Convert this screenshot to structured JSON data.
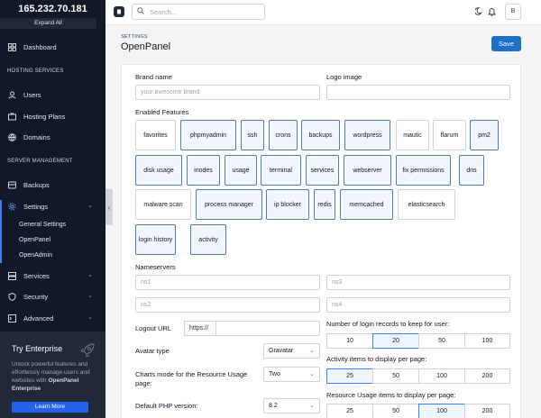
{
  "sidebar": {
    "ip": "165.232.70.181",
    "expand_all": "Expand All",
    "dashboard": "Dashboard",
    "section_hosting": "HOSTING SERVICES",
    "users": "Users",
    "hosting_plans": "Hosting Plans",
    "domains": "Domains",
    "section_server": "SERVER MANAGEMENT",
    "backups": "Backups",
    "settings": "Settings",
    "sub": [
      "General Settings",
      "OpenPanel",
      "OpenAdmin"
    ],
    "services": "Services",
    "security": "Security",
    "advanced": "Advanced",
    "enterprise_title": "Try Enterprise",
    "enterprise_text_1": "Unlock powerful features and effortlessly manage users and websites with",
    "enterprise_text_2": "OpenPanel Enterprise",
    "learn_more": "Learn More"
  },
  "topbar": {
    "search_placeholder": "Search...",
    "avatar": "B"
  },
  "header": {
    "crumb": "SETTINGS",
    "title": "OpenPanel",
    "save": "Save"
  },
  "form": {
    "brand_name_label": "Brand name",
    "brand_name_placeholder": "your awesome brand",
    "logo_label": "Logo image",
    "features_label": "Enabled Features",
    "features": [
      {
        "name": "favorites",
        "on": false
      },
      {
        "name": "phpmyadmin",
        "on": true
      },
      {
        "name": "ssh",
        "on": true
      },
      {
        "name": "crons",
        "on": true
      },
      {
        "name": "backups",
        "on": true
      },
      {
        "name": "wordpress",
        "on": true
      },
      {
        "name": "mautic",
        "on": false
      },
      {
        "name": "flarum",
        "on": false
      },
      {
        "name": "pm2",
        "on": true
      },
      {
        "name": "disk usage",
        "on": true
      },
      {
        "name": "inodes",
        "on": true
      },
      {
        "name": "usage",
        "on": true
      },
      {
        "name": "terminal",
        "on": true
      },
      {
        "name": "services",
        "on": true
      },
      {
        "name": "webserver",
        "on": true
      },
      {
        "name": "fix permissions",
        "on": true
      },
      {
        "name": "dns",
        "on": true
      },
      {
        "name": "malware scan",
        "on": false
      },
      {
        "name": "process manager",
        "on": true
      },
      {
        "name": "ip blocker",
        "on": true
      },
      {
        "name": "redis",
        "on": true
      },
      {
        "name": "memcached",
        "on": true
      },
      {
        "name": "elasticsearch",
        "on": false
      },
      {
        "name": "login history",
        "on": true
      },
      {
        "name": "activity",
        "on": true
      }
    ],
    "nameservers_label": "Nameservers",
    "ns": [
      "ns1",
      "ns3",
      "ns2",
      "ns4"
    ],
    "logout_label": "Logout URL",
    "logout_prefix": "https://",
    "avatar_label": "Avatar type",
    "avatar_value": "Gravatar",
    "charts_label_1": "Charts mode for the Resource Usage",
    "charts_label_2": "page:",
    "charts_value": "Two",
    "php_label": "Default PHP version:",
    "php_value": "8.2",
    "login_records_label": "Number of login records to keep for user:",
    "login_records": [
      "10",
      "20",
      "50",
      "100"
    ],
    "login_records_selected": "20",
    "activity_label": "Activity items to display per page:",
    "activity": [
      "25",
      "50",
      "100",
      "200"
    ],
    "activity_selected": "25",
    "usage_label": "Resource Usage items to display per page:",
    "usage": [
      "25",
      "50",
      "100",
      "200"
    ],
    "usage_selected": "100"
  }
}
